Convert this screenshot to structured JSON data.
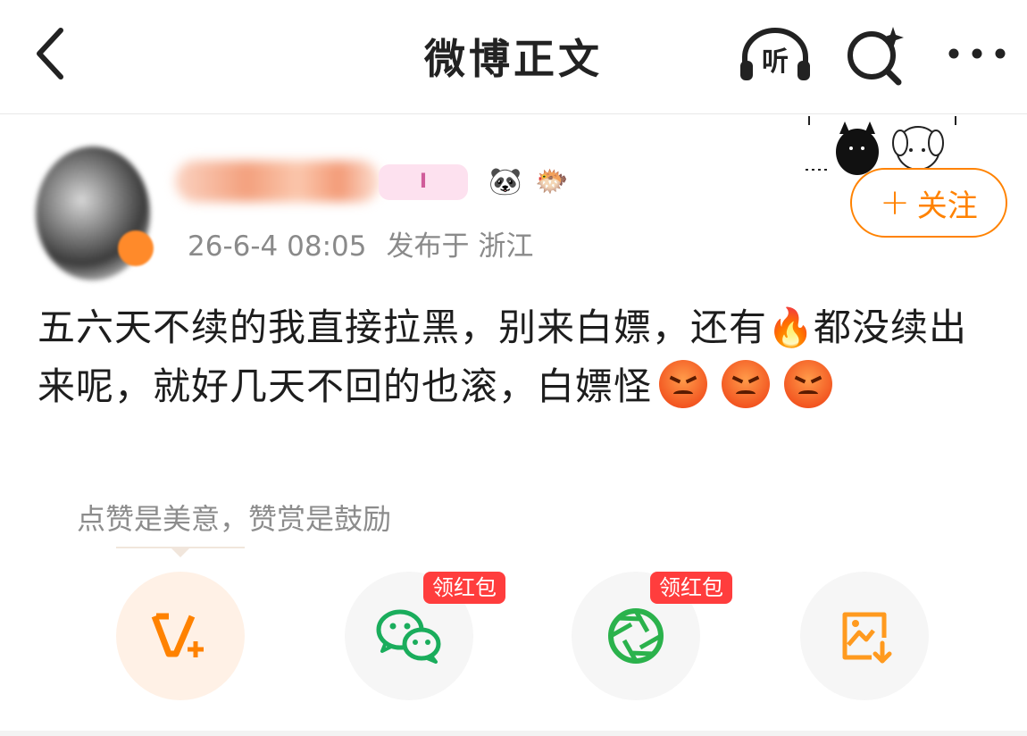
{
  "header": {
    "title": "微博正文",
    "back_icon": "chevron-left-icon",
    "listen_label": "听",
    "search_icon": "search-sparkle-icon",
    "more_icon": "more-horizontal-icon"
  },
  "author": {
    "meta_time": "26-6-4 08:05",
    "meta_location": "发布于 浙江",
    "follow_label": "关注",
    "badge_vip_text": "I",
    "badge_panda": "🐼",
    "badge_fish": "🐡"
  },
  "post": {
    "line1_pre": "五六天不续的我直接拉黑，别来白嫖，还有",
    "fire_emoji": "🔥",
    "line1_post": "都没续出来呢，就好几天不回的也滚，白嫖怪"
  },
  "reward": {
    "hint": "点赞是美意，赞赏是鼓励"
  },
  "actions": {
    "vplus_label": "V",
    "redpack_label": "领红包",
    "redpack_label_2": "领红包"
  },
  "colors": {
    "accent": "#ff8200",
    "redpack": "#ff3d3d",
    "wechat_green": "#07c160"
  }
}
